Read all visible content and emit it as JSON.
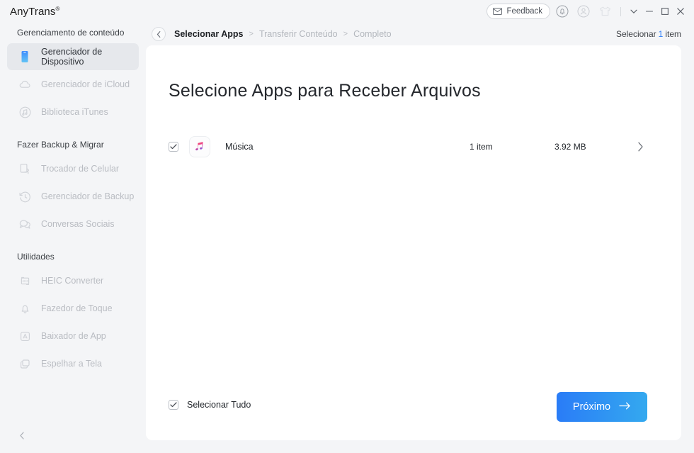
{
  "titlebar": {
    "brand": "AnyTrans",
    "brand_mark": "®",
    "feedback_label": "Feedback",
    "icons": {
      "feedback": "envelope-icon",
      "notification": "bell-icon",
      "account": "person-icon",
      "skin": "tshirt-icon",
      "more": "chevron-down-icon",
      "minimize": "minimize-icon",
      "maximize": "maximize-icon",
      "close": "close-icon"
    }
  },
  "sidebar": {
    "sections": [
      {
        "title": "Gerenciamento de conteúdo",
        "items": [
          {
            "label": "Gerenciador de Dispositivo",
            "icon": "device-icon",
            "active": true,
            "disabled": false
          },
          {
            "label": "Gerenciador de iCloud",
            "icon": "cloud-icon",
            "active": false,
            "disabled": true
          },
          {
            "label": "Biblioteca iTunes",
            "icon": "itunes-note-icon",
            "active": false,
            "disabled": true
          }
        ]
      },
      {
        "title": "Fazer Backup & Migrar",
        "items": [
          {
            "label": "Trocador de Celular",
            "icon": "phone-switch-icon",
            "active": false,
            "disabled": true
          },
          {
            "label": "Gerenciador de Backup",
            "icon": "clock-restore-icon",
            "active": false,
            "disabled": true
          },
          {
            "label": "Conversas Sociais",
            "icon": "chat-bubbles-icon",
            "active": false,
            "disabled": true
          }
        ]
      },
      {
        "title": "Utilidades",
        "items": [
          {
            "label": "HEIC Converter",
            "icon": "heic-icon",
            "active": false,
            "disabled": true
          },
          {
            "label": "Fazedor de Toque",
            "icon": "bell-outline-icon",
            "active": false,
            "disabled": true
          },
          {
            "label": "Baixador de App",
            "icon": "appstore-icon",
            "active": false,
            "disabled": true
          },
          {
            "label": "Espelhar a Tela",
            "icon": "screens-icon",
            "active": false,
            "disabled": true
          }
        ]
      }
    ],
    "collapse_icon": "chevron-left-icon"
  },
  "breadcrumb": {
    "back_icon": "chevron-left-icon",
    "steps": [
      {
        "label": "Selecionar Apps",
        "current": true
      },
      {
        "label": "Transferir Conteúdo",
        "current": false
      },
      {
        "label": "Completo",
        "current": false
      }
    ],
    "separator": ">"
  },
  "selection_status": {
    "prefix": "Selecionar",
    "count": "1",
    "suffix": "item",
    "accent_color": "#2a7cf7"
  },
  "main": {
    "title": "Selecione Apps para Receber Arquivos",
    "apps": [
      {
        "name": "Música",
        "icon": "apple-music-icon",
        "count": "1 item",
        "size": "3.92 MB",
        "checked": true,
        "chevron": "chevron-right-icon"
      }
    ]
  },
  "footer": {
    "select_all_label": "Selecionar Tudo",
    "select_all_checked": true,
    "next_label": "Próximo",
    "next_icon": "arrow-right-icon",
    "next_gradient_from": "#2a7cf7",
    "next_gradient_to": "#34a9ef"
  }
}
